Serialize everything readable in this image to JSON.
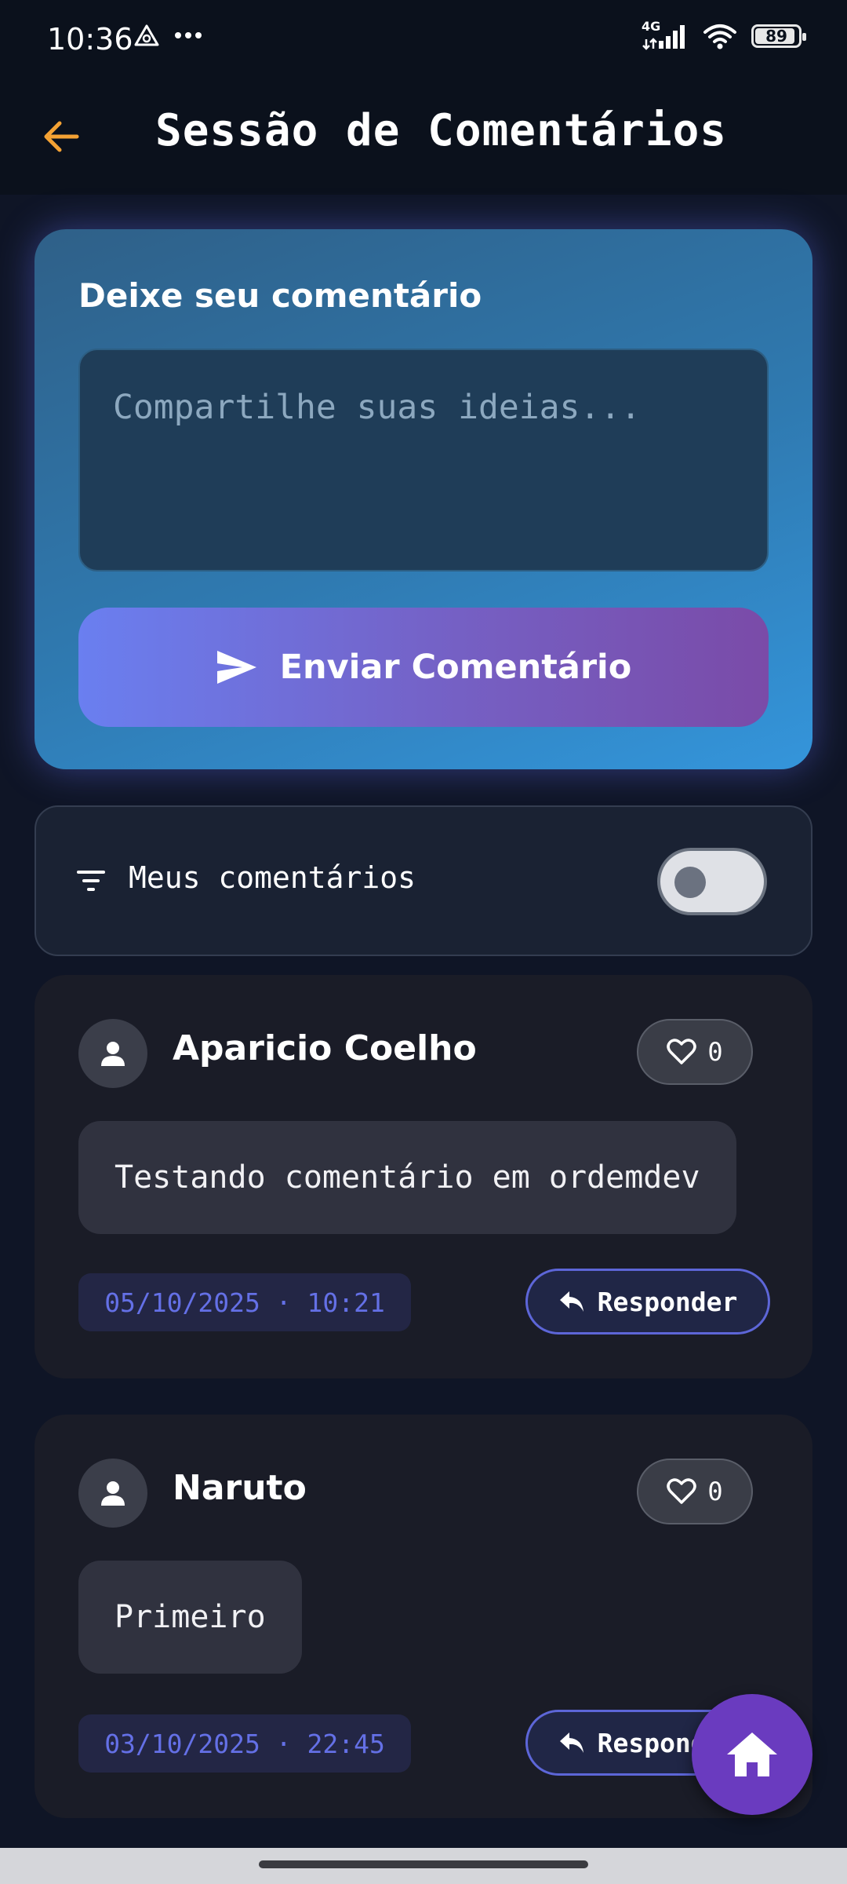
{
  "status_bar": {
    "time": "10:36",
    "network": "4G",
    "battery": "89",
    "icons": [
      "delta-icon",
      "more-dots-icon",
      "signal-icon",
      "wifi-icon",
      "battery-icon"
    ]
  },
  "app_bar": {
    "title": "Sessão de Comentários",
    "back_icon": "arrow-left-icon",
    "accent_color": "#f4a234"
  },
  "composer": {
    "title": "Deixe seu comentário",
    "input_value": "",
    "input_placeholder": "Compartilhe suas ideias...",
    "send_label": "Enviar Comentário",
    "send_icon": "send-icon"
  },
  "filter": {
    "label": "Meus comentários",
    "icon": "filter-icon",
    "toggle_on": false
  },
  "comments": [
    {
      "author": "Aparicio Coelho",
      "likes": "0",
      "text": "Testando comentário em ordemdev",
      "date": "05/10/2025 · 10:21",
      "reply_label": "Responder"
    },
    {
      "author": "Naruto",
      "likes": "0",
      "text": "Primeiro",
      "date": "03/10/2025 · 22:45",
      "reply_label": "Responder"
    }
  ],
  "fab": {
    "icon": "home-icon",
    "color": "#6a3bbf"
  }
}
